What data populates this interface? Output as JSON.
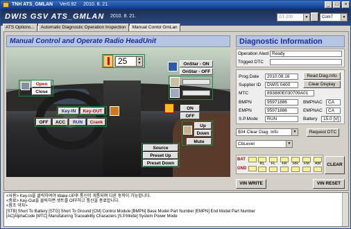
{
  "titlebar": {
    "title": "TNH ATS_GMLAN",
    "version": "Ver0.92",
    "date": "2010. 8. 21.",
    "minimize": "_",
    "maximize": "□",
    "close": "×"
  },
  "header": {
    "brand": "DWIS GSV ATS_GMLAN",
    "date": "2010. 8. 21.",
    "device_select": "GT-200",
    "port_select": "Com7"
  },
  "tabs": [
    {
      "label": "ATS Options..."
    },
    {
      "label": "Automatic Diagnostic Operation Inspection"
    },
    {
      "label": "Manual Contol GmLan"
    }
  ],
  "left": {
    "title": "Manual Control and Operate  Radio HeadUnit",
    "temperature": "25",
    "onstar_on": "OnStar - ON",
    "onstar_off": "OnStar - OFF",
    "door_open": "Open",
    "door_close": "Close",
    "key_in": "Key-IN",
    "key_out": "Key-OUT",
    "power_off": "OFF",
    "power_acc": "ACC",
    "power_run": "RUN",
    "power_crank": "Crank",
    "on": "ON",
    "off": "OFF",
    "vol_up": "Up",
    "vol_down": "Down",
    "mute": "Mute",
    "source": "Source",
    "preset_up": "Preset Up",
    "preset_down": "Preset Down"
  },
  "right": {
    "title": "Diagnostic Information",
    "operation_label": "Operation Alwd",
    "operation_value": "Ready",
    "trigged_label": "Trigged DTC",
    "trigged_value": "",
    "prog_date_label": "Prog.Date",
    "prog_date_value": "2010.08.16",
    "supplier_label": "Supplier ID",
    "supplier_value": "DWIS 0400",
    "mtc_label": "MTC",
    "mtc_value": "893880E030709A01",
    "bmpn_label": "BMPN",
    "bmpn_value": "95971886",
    "bmpnac_label": "BMPNAC",
    "bmpnac_value": "CA",
    "empn_label": "EMPN",
    "empn_value": "95971886",
    "empnac_label": "EMPNAC",
    "empnac_value": "CA",
    "spmode_label": "S.P.Mode",
    "spmode_value": "RUN",
    "battery_label": "Battery",
    "battery_value": "15.0 [V]",
    "read_diag": "Read Diag.Info",
    "clear_display": "Clear Display",
    "dtc_select": "$04 Clear Diag. Info",
    "request_dtc": "Request DTC",
    "level_select": "CbLevel",
    "clear": "CLEAR",
    "vin_write": "VIN WRITE",
    "vin_reset": "VIN RESET"
  },
  "signals": {
    "bat": "BAT",
    "gnd": "GND",
    "items": [
      "RL",
      "FL",
      "FR",
      "RR",
      "FM",
      "AM"
    ]
  },
  "log": [
    "<사용> Key-In을 클릭하여야 Wake-UP후 통신이 개통되며 다른 동작이 가능합니다.",
    "<종료> Key-Out을 클릭하면 셋트를 OFF하고 통신을 종료합니다.",
    "<참조 약자>",
    "  [STB] Short To Battery   [STG] Short To Ground   [CM] Control Module  [BMPN] Base Model Part Number  [EMPN] End Model Part Number",
    "  [AC]AlphaCode   [MTC] Manufaturing Traceability Characters  [S.P.Mode] System Power Mode"
  ]
}
